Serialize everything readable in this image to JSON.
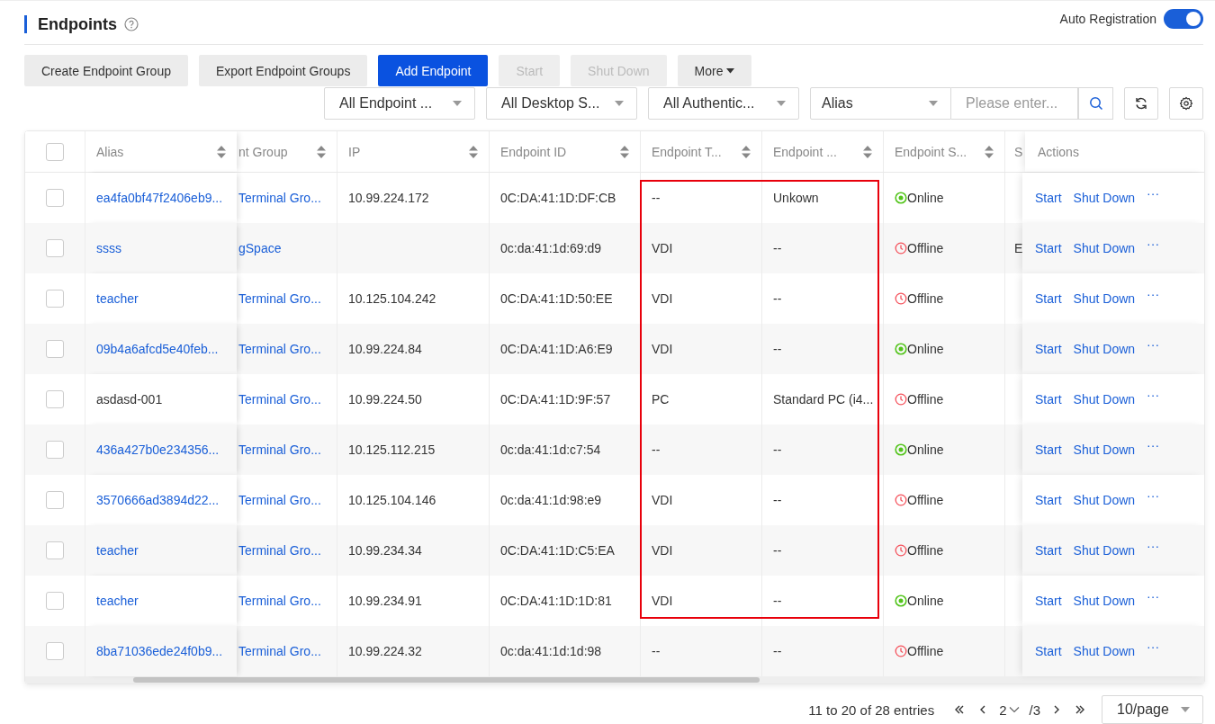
{
  "header": {
    "title": "Endpoints",
    "auto_registration": {
      "label": "Auto Registration",
      "on": true
    }
  },
  "toolbar": [
    {
      "label": "Create Endpoint Group",
      "kind": "default",
      "disabled": false
    },
    {
      "label": "Export Endpoint Groups",
      "kind": "default",
      "disabled": false
    },
    {
      "label": "Add Endpoint",
      "kind": "primary",
      "disabled": false
    },
    {
      "label": "Start",
      "kind": "default",
      "disabled": true
    },
    {
      "label": "Shut Down",
      "kind": "default",
      "disabled": true
    },
    {
      "label": "More",
      "kind": "menu",
      "disabled": false
    }
  ],
  "filters": [
    {
      "value": "All Endpoint ..."
    },
    {
      "value": "All Desktop S..."
    },
    {
      "value": "All Authentic..."
    }
  ],
  "search": {
    "field": "Alias",
    "placeholder": "Please enter..."
  },
  "table": {
    "columns": [
      {
        "kind": "checkbox",
        "checked": false
      },
      {
        "kind": "text",
        "label": "Alias",
        "sortable": true
      },
      {
        "kind": "text",
        "label": "nt Group",
        "sortable": true
      },
      {
        "kind": "text",
        "label": "IP",
        "sortable": true
      },
      {
        "kind": "text",
        "label": "Endpoint ID",
        "sortable": true
      },
      {
        "kind": "text",
        "label": "Endpoint T...",
        "sortable": true
      },
      {
        "kind": "text",
        "label": "Endpoint ...",
        "sortable": true
      },
      {
        "kind": "text",
        "label": "Endpoint S...",
        "sortable": true
      },
      {
        "kind": "text",
        "label": "S",
        "sortable": false
      },
      {
        "kind": "text",
        "label": "Actions",
        "sortable": false
      }
    ],
    "rows": [
      {
        "checked": false,
        "alias": "ea4fa0bf47f2406eb9...",
        "alias_link": true,
        "group": "Terminal Gro...",
        "ip": "10.99.224.172",
        "endpoint_id": "0C:DA:41:1D:DF:CB",
        "type": "--",
        "model": "Unkown",
        "status": "Online",
        "online": true,
        "actions": [
          "Start",
          "Shut Down",
          "···"
        ],
        "highlighted": true
      },
      {
        "checked": false,
        "alias": "ssss",
        "alias_link": true,
        "group": "gSpace",
        "endpoint_id": "0c:da:41:1d:69:d9",
        "type": "VDI",
        "model": "--",
        "status": "Offline",
        "online": false,
        "column_9": "E",
        "actions": [
          "Start",
          "Shut Down",
          "···"
        ],
        "highlighted": true
      },
      {
        "checked": false,
        "alias": "teacher",
        "alias_link": true,
        "group": "Terminal Gro...",
        "ip": "10.125.104.242",
        "endpoint_id": "0C:DA:41:1D:50:EE",
        "type": "VDI",
        "model": "--",
        "status": "Offline",
        "online": false,
        "actions": [
          "Start",
          "Shut Down",
          "···"
        ],
        "highlighted": true
      },
      {
        "checked": false,
        "alias": "09b4a6afcd5e40feb...",
        "alias_link": true,
        "group": "Terminal Gro...",
        "ip": "10.99.224.84",
        "endpoint_id": "0C:DA:41:1D:A6:E9",
        "type": "VDI",
        "model": "--",
        "status": "Online",
        "online": true,
        "actions": [
          "Start",
          "Shut Down",
          "···"
        ],
        "highlighted": true
      },
      {
        "checked": false,
        "alias": "asdasd-001",
        "alias_link": false,
        "group": "Terminal Gro...",
        "ip": "10.99.224.50",
        "endpoint_id": "0C:DA:41:1D:9F:57",
        "type": "PC",
        "model": "Standard PC (i4...",
        "status": "Offline",
        "online": false,
        "actions": [
          "Start",
          "Shut Down",
          "···"
        ],
        "highlighted": true
      },
      {
        "checked": false,
        "alias": "436a427b0e234356...",
        "alias_link": true,
        "group": "Terminal Gro...",
        "ip": "10.125.112.215",
        "endpoint_id": "0c:da:41:1d:c7:54",
        "type": "--",
        "model": "--",
        "status": "Online",
        "online": true,
        "actions": [
          "Start",
          "Shut Down",
          "···"
        ],
        "highlighted": true
      },
      {
        "checked": false,
        "alias": "3570666ad3894d22...",
        "alias_link": true,
        "group": "Terminal Gro...",
        "ip": "10.125.104.146",
        "endpoint_id": "0c:da:41:1d:98:e9",
        "type": "VDI",
        "model": "--",
        "status": "Offline",
        "online": false,
        "actions": [
          "Start",
          "Shut Down",
          "···"
        ],
        "highlighted": true
      },
      {
        "checked": false,
        "alias": "teacher",
        "alias_link": true,
        "group": "Terminal Gro...",
        "ip": "10.99.234.34",
        "endpoint_id": "0C:DA:41:1D:C5:EA",
        "type": "VDI",
        "model": "--",
        "status": "Offline",
        "online": false,
        "actions": [
          "Start",
          "Shut Down",
          "···"
        ],
        "highlighted": true
      },
      {
        "checked": false,
        "alias": "teacher",
        "alias_link": true,
        "group": "Terminal Gro...",
        "ip": "10.99.234.91",
        "endpoint_id": "0C:DA:41:1D:1D:81",
        "type": "VDI",
        "model": "--",
        "status": "Online",
        "online": true,
        "actions": [
          "Start",
          "Shut Down",
          "···"
        ],
        "highlighted": true
      },
      {
        "checked": false,
        "alias": "8ba71036ede24f0b9...",
        "alias_link": true,
        "group": "Terminal Gro...",
        "ip": "10.99.224.32",
        "endpoint_id": "0c:da:41:1d:1d:98",
        "type": "--",
        "model": "--",
        "status": "Offline",
        "online": false,
        "actions": [
          "Start",
          "Shut Down",
          "···"
        ],
        "highlighted": false
      }
    ]
  },
  "pagination": {
    "summary": "11 to 20 of 28 entries",
    "page": "2",
    "total": "/3",
    "page_size": "10/page"
  }
}
